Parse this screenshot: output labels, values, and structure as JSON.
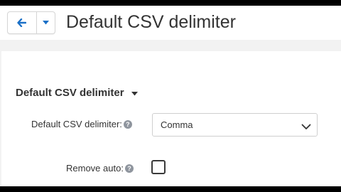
{
  "header": {
    "title": "Default CSV delimiter",
    "back_icon": "arrow-left-icon",
    "menu_icon": "caret-down-icon",
    "accent_color": "#1b70c7"
  },
  "section": {
    "heading": "Default CSV delimiter",
    "heading_icon": "caret-down-icon"
  },
  "fields": {
    "delimiter": {
      "label": "Default CSV delimiter:",
      "help_glyph": "?",
      "selected_value": "Comma"
    },
    "remove_auto": {
      "label": "Remove auto:",
      "help_glyph": "?",
      "checked": false
    }
  }
}
